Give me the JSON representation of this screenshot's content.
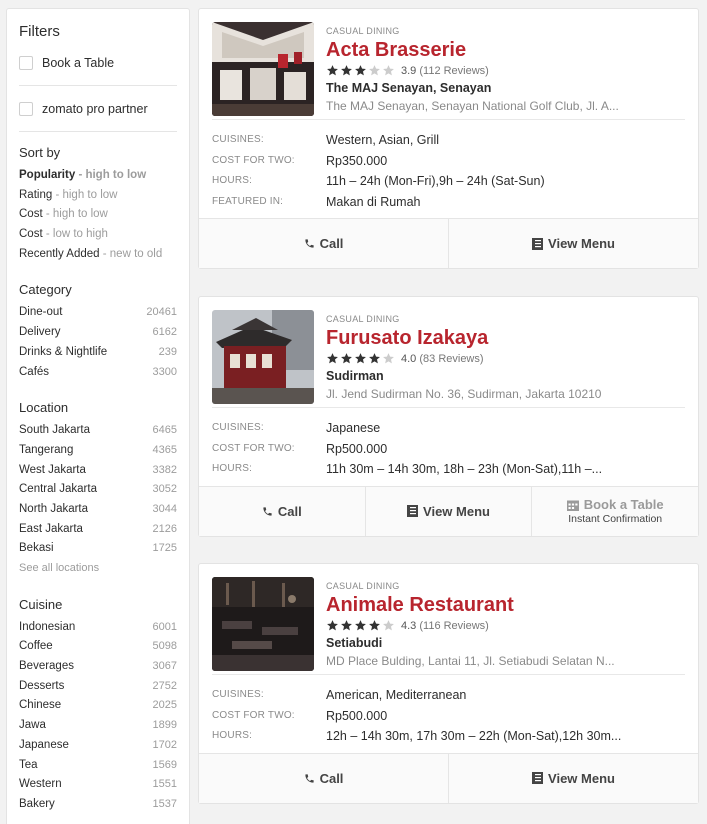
{
  "filters": {
    "title": "Filters",
    "checks": [
      "Book a Table",
      "zomato pro partner"
    ]
  },
  "sort": {
    "title": "Sort by",
    "items": [
      {
        "label": "Popularity",
        "hint": "- high to low"
      },
      {
        "label": "Rating",
        "hint": "- high to low"
      },
      {
        "label": "Cost",
        "hint": "- high to low"
      },
      {
        "label": "Cost",
        "hint": "- low to high"
      },
      {
        "label": "Recently Added",
        "hint": "- new to old"
      }
    ]
  },
  "category": {
    "title": "Category",
    "items": [
      {
        "label": "Dine-out",
        "count": "20461"
      },
      {
        "label": "Delivery",
        "count": "6162"
      },
      {
        "label": "Drinks & Nightlife",
        "count": "239"
      },
      {
        "label": "Cafés",
        "count": "3300"
      }
    ]
  },
  "location": {
    "title": "Location",
    "items": [
      {
        "label": "South Jakarta",
        "count": "6465"
      },
      {
        "label": "Tangerang",
        "count": "4365"
      },
      {
        "label": "West Jakarta",
        "count": "3382"
      },
      {
        "label": "Central Jakarta",
        "count": "3052"
      },
      {
        "label": "North Jakarta",
        "count": "3044"
      },
      {
        "label": "East Jakarta",
        "count": "2126"
      },
      {
        "label": "Bekasi",
        "count": "1725"
      }
    ],
    "see_all": "See all locations"
  },
  "cuisine": {
    "title": "Cuisine",
    "items": [
      {
        "label": "Indonesian",
        "count": "6001"
      },
      {
        "label": "Coffee",
        "count": "5098"
      },
      {
        "label": "Beverages",
        "count": "3067"
      },
      {
        "label": "Desserts",
        "count": "2752"
      },
      {
        "label": "Chinese",
        "count": "2025"
      },
      {
        "label": "Jawa",
        "count": "1899"
      },
      {
        "label": "Japanese",
        "count": "1702"
      },
      {
        "label": "Tea",
        "count": "1569"
      },
      {
        "label": "Western",
        "count": "1551"
      },
      {
        "label": "Bakery",
        "count": "1537"
      }
    ]
  },
  "labels": {
    "cuisines": "CUISINES:",
    "cost": "COST FOR TWO:",
    "hours": "HOURS:",
    "featured": "FEATURED IN:",
    "call": "Call",
    "view_menu": "View Menu",
    "book_table": "Book a Table",
    "instant": "Instant Confirmation"
  },
  "restaurants": [
    {
      "type": "CASUAL DINING",
      "name": "Acta Brasserie",
      "rating": "3.9",
      "rating_value": 3.9,
      "reviews": "(112 Reviews)",
      "locality": "The MAJ Senayan, Senayan",
      "address": "The MAJ Senayan, Senayan National Golf Club, Jl. A...",
      "cuisines": "Western, Asian, Grill",
      "cost": "Rp350.000",
      "hours": "11h – 24h (Mon-Fri),9h – 24h (Sat-Sun)",
      "featured": "Makan di Rumah"
    },
    {
      "type": "CASUAL DINING",
      "name": "Furusato Izakaya",
      "rating": "4.0",
      "rating_value": 4.0,
      "reviews": "(83 Reviews)",
      "locality": "Sudirman",
      "address": "Jl. Jend Sudirman No. 36, Sudirman, Jakarta 10210",
      "cuisines": "Japanese",
      "cost": "Rp500.000",
      "hours": "11h 30m – 14h 30m, 18h – 23h (Mon-Sat),11h –..."
    },
    {
      "type": "CASUAL DINING",
      "name": "Animale Restaurant",
      "rating": "4.3",
      "rating_value": 4.3,
      "reviews": "(116 Reviews)",
      "locality": "Setiabudi",
      "address": "MD Place Bulding, Lantai 11, Jl. Setiabudi Selatan N...",
      "cuisines": "American, Mediterranean",
      "cost": "Rp500.000",
      "hours": "12h – 14h 30m, 17h 30m – 22h (Mon-Sat),12h 30m..."
    }
  ],
  "colors": {
    "brand_red": "#b8252e",
    "star_filled": "#333333",
    "star_empty": "#cccccc"
  }
}
